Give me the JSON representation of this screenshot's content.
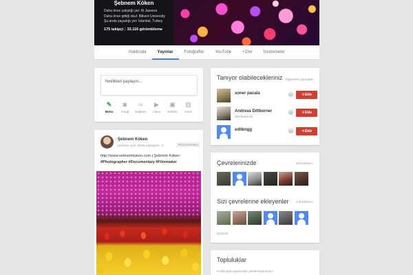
{
  "profile": {
    "name": "Şebnem Köken",
    "info": [
      "Daha önce çalıştığı yer: Al Jazeera",
      "Daha önce gittiği okul: Bilkent University",
      "Şu anda yaşadığı yer: Istanbul, Turkey"
    ],
    "followers": "175 takipçi",
    "views": "33.116 görüntüleme"
  },
  "tabs": [
    {
      "label": "Hakkında",
      "active": false
    },
    {
      "label": "Yayınlar",
      "active": true
    },
    {
      "label": "Fotoğraflar",
      "active": false
    },
    {
      "label": "YouTube",
      "active": false
    },
    {
      "label": "+1'ler",
      "active": false
    },
    {
      "label": "İncelemeler",
      "active": false
    }
  ],
  "share": {
    "placeholder": "Yenilikleri paylaşın...",
    "actions": [
      {
        "label": "Metin",
        "icon": "pencil-icon",
        "glyph": "✎",
        "active": true
      },
      {
        "label": "Fotoğ",
        "icon": "camera-icon",
        "glyph": "◙",
        "active": false
      },
      {
        "label": "Bağlantı",
        "icon": "link-icon",
        "glyph": "∞",
        "active": false
      },
      {
        "label": "Video",
        "icon": "video-icon",
        "glyph": "▶",
        "active": false
      },
      {
        "label": "Etkinlik",
        "icon": "event-icon",
        "glyph": "▣",
        "active": false
      },
      {
        "label": "Anket",
        "icon": "poll-icon",
        "glyph": "▥",
        "active": false
      }
    ]
  },
  "post": {
    "author": "Şebnem Köken",
    "meta": "Herkese açık olarak paylaşıldı · 2",
    "tag": "#Documentary",
    "line1": "http://www.sebnemkoken.com | Şebnem Köken",
    "line2": "#Photographer #Documentary #Filmmaker"
  },
  "people": {
    "title": "Tanıyor olabilecekleriniz",
    "more": "Diğerlerini görüntüle",
    "add_label": "Ekle",
    "items": [
      {
        "name": "soner pacala",
        "sub": ""
      },
      {
        "name": "Andreas Dittberner",
        "sub": "aboutpixel.de"
      },
      {
        "name": "editkngg",
        "sub": ""
      }
    ]
  },
  "circles": {
    "in_title": "Çevrelerinizde",
    "in_count": "323 kullanıcı",
    "adders_title": "Sizi çevrelerine ekleyenler",
    "adders_count": "175 kullanıcı",
    "edit_link": "Düzenle"
  },
  "communities": {
    "title": "Topluluklar",
    "text": "Profilinizde toplulukları göstermiyorsunuz."
  },
  "colors": {
    "accent": "#427fed",
    "add_button": "#d23f31",
    "avatar_blank": "#4d8cf5"
  }
}
